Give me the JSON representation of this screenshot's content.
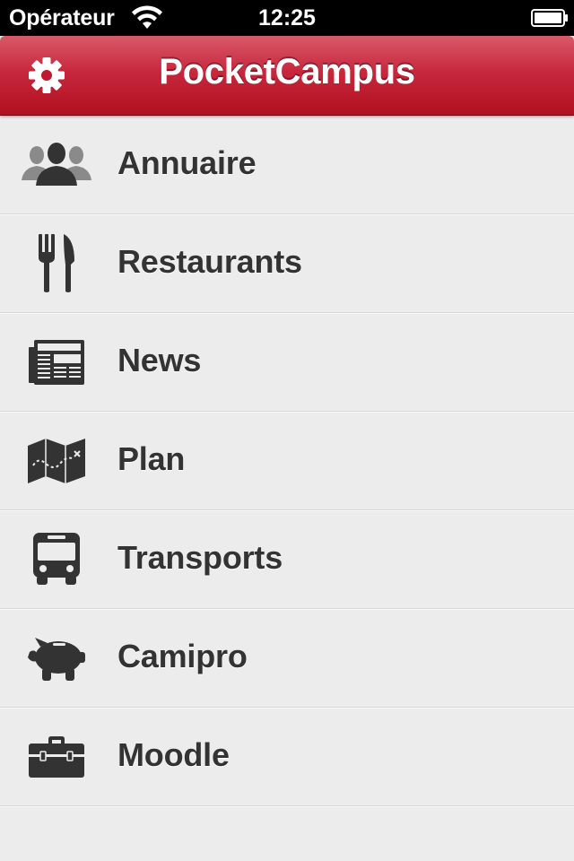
{
  "status_bar": {
    "carrier": "Opérateur",
    "time": "12:25",
    "wifi_icon": "wifi-icon",
    "battery_icon": "battery-icon"
  },
  "nav_bar": {
    "title": "PocketCampus",
    "settings_icon": "gear-icon",
    "color": "#c0182c"
  },
  "menu": {
    "items": [
      {
        "label": "Annuaire",
        "icon": "people-icon"
      },
      {
        "label": "Restaurants",
        "icon": "fork-knife-icon"
      },
      {
        "label": "News",
        "icon": "newspaper-icon"
      },
      {
        "label": "Plan",
        "icon": "map-icon"
      },
      {
        "label": "Transports",
        "icon": "bus-icon"
      },
      {
        "label": "Camipro",
        "icon": "piggy-bank-icon"
      },
      {
        "label": "Moodle",
        "icon": "briefcase-icon"
      }
    ]
  }
}
